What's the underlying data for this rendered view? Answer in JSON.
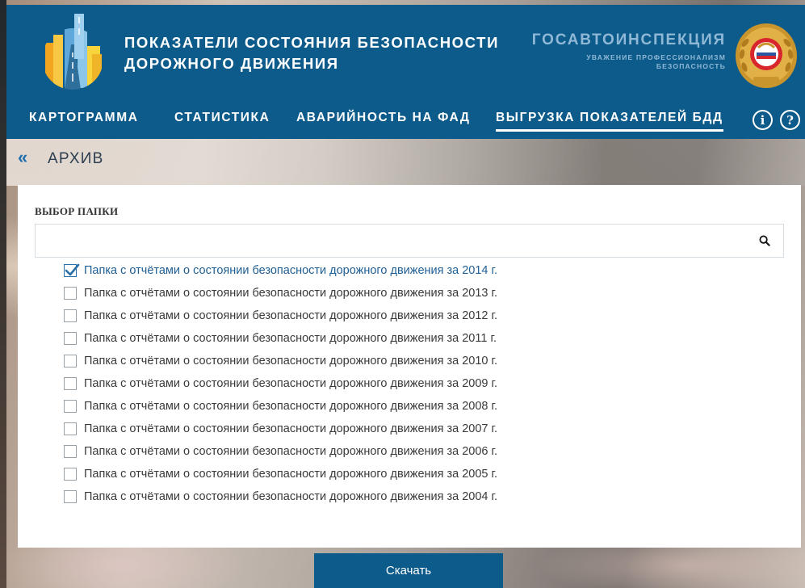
{
  "header": {
    "title_line1": "ПОКАЗАТЕЛИ СОСТОЯНИЯ БЕЗОПАСНОСТИ",
    "title_line2": "ДОРОЖНОГО ДВИЖЕНИЯ",
    "brand_name": "ГОСАВТОИНСПЕКЦИЯ",
    "brand_slogan_line1": "УВАЖЕНИЕ ПРОФЕССИОНАЛИЗМ",
    "brand_slogan_line2": "БЕЗОПАСНОСТЬ",
    "logo_icon": "city-road-logo-icon",
    "emblem_icon": "gai-emblem-icon"
  },
  "nav": {
    "items": [
      "КАРТОГРАММА",
      "СТАТИСТИКА",
      "АВАРИЙНОСТЬ НА ФАД",
      "ВЫГРУЗКА ПОКАЗАТЕЛЕЙ БДД"
    ],
    "active": "ВЫГРУЗКА ПОКАЗАТЕЛЕЙ БДД",
    "info_icon": "i",
    "help_icon": "?"
  },
  "breadcrumb": {
    "back_icon": "«",
    "label": "АРХИВ"
  },
  "panel": {
    "title": "ВЫБОР ПАПКИ",
    "search_value": "",
    "folders": [
      {
        "label": "Папка с отчётами о состоянии безопасности дорожного движения за 2014 г.",
        "checked": true
      },
      {
        "label": "Папка с отчётами о состоянии безопасности дорожного движения за 2013 г.",
        "checked": false
      },
      {
        "label": "Папка с отчётами о состоянии безопасности дорожного движения за 2012 г.",
        "checked": false
      },
      {
        "label": "Папка с отчётами о состоянии безопасности дорожного движения за 2011 г.",
        "checked": false
      },
      {
        "label": "Папка с отчётами о состоянии безопасности дорожного движения за 2010 г.",
        "checked": false
      },
      {
        "label": "Папка с отчётами о состоянии безопасности дорожного движения за 2009 г.",
        "checked": false
      },
      {
        "label": "Папка с отчётами о состоянии безопасности дорожного движения за 2008 г.",
        "checked": false
      },
      {
        "label": "Папка с отчётами о состоянии безопасности дорожного движения за 2007 г.",
        "checked": false
      },
      {
        "label": "Папка с отчётами о состоянии безопасности дорожного движения за 2006 г.",
        "checked": false
      },
      {
        "label": "Папка с отчётами о состоянии безопасности дорожного движения за 2005 г.",
        "checked": false
      },
      {
        "label": "Папка с отчётами о состоянии безопасности дорожного движения за 2004 г.",
        "checked": false
      }
    ]
  },
  "download_label": "Скачать",
  "colors": {
    "header_bg": "#0d5b8a",
    "brand_text": "#8fb8d6",
    "check_accent": "#2a6fa8"
  }
}
